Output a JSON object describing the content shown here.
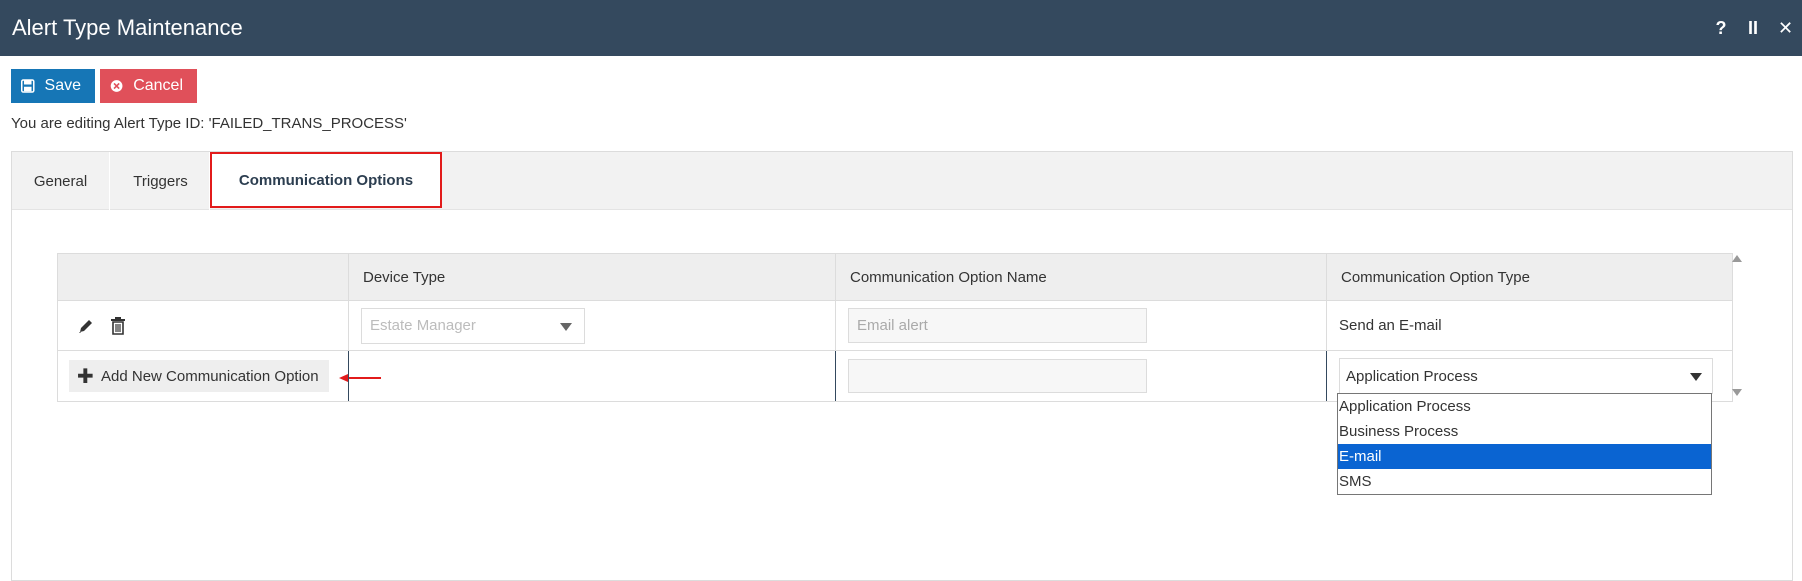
{
  "window": {
    "title": "Alert Type Maintenance",
    "controls": {
      "help": "?",
      "pause": "II",
      "close": "✕"
    }
  },
  "toolbar": {
    "save_label": "Save",
    "cancel_label": "Cancel"
  },
  "edit_info": "You are editing Alert Type ID: 'FAILED_TRANS_PROCESS'",
  "tabs": [
    {
      "label": "General"
    },
    {
      "label": "Triggers"
    },
    {
      "label": "Communication Options",
      "active": true
    }
  ],
  "grid": {
    "headers": [
      "",
      "Device Type",
      "Communication Option Name",
      "Communication Option Type"
    ],
    "rows": [
      {
        "device_type": "Estate Manager",
        "option_name": "Email alert",
        "option_type": "Send an E-mail"
      }
    ],
    "new_row": {
      "add_label": "Add New Communication Option",
      "option_name": "",
      "option_type_selected": "Application Process",
      "option_type_options": [
        "Application Process",
        "Business Process",
        "E-mail",
        "SMS"
      ],
      "highlighted_option": "E-mail"
    }
  },
  "colors": {
    "titlebar": "#34495e",
    "save": "#1676b6",
    "cancel": "#e0505a",
    "highlight_box": "#e21b1b",
    "dropdown_selected": "#0a64d2"
  }
}
